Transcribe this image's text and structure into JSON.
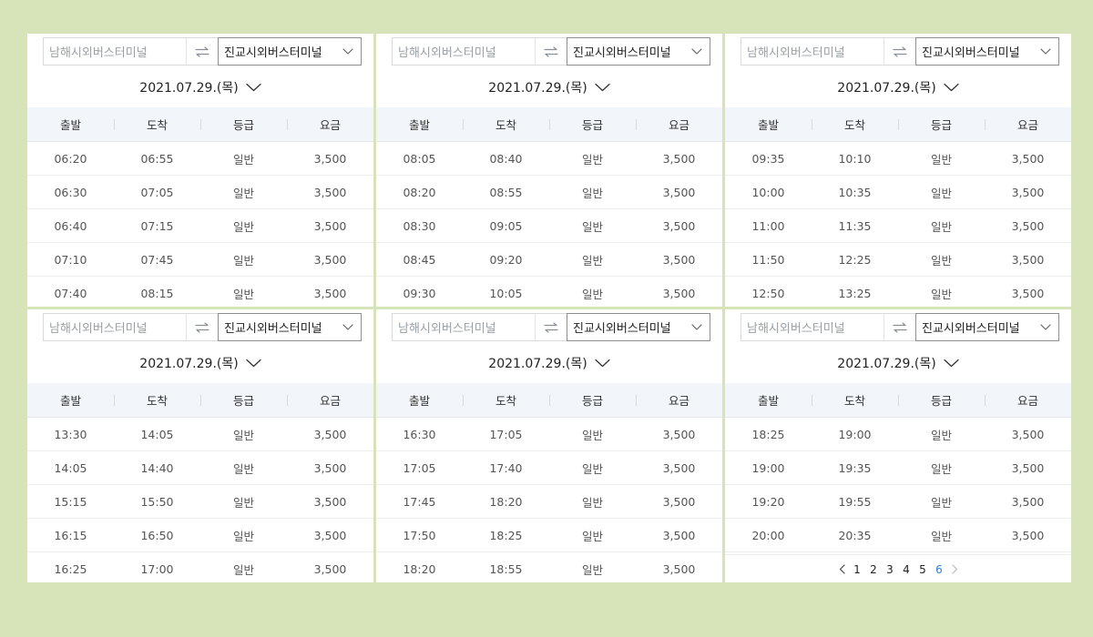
{
  "common": {
    "origin_placeholder": "남해시외버스터미널",
    "destination": "진교시외버스터미널",
    "date": "2021.07.29.(목)",
    "headers": [
      "출발",
      "도착",
      "등급",
      "요금"
    ]
  },
  "panels": [
    {
      "rows": [
        [
          "06:20",
          "06:55",
          "일반",
          "3,500"
        ],
        [
          "06:30",
          "07:05",
          "일반",
          "3,500"
        ],
        [
          "06:40",
          "07:15",
          "일반",
          "3,500"
        ],
        [
          "07:10",
          "07:45",
          "일반",
          "3,500"
        ],
        [
          "07:40",
          "08:15",
          "일반",
          "3,500"
        ]
      ]
    },
    {
      "rows": [
        [
          "08:05",
          "08:40",
          "일반",
          "3,500"
        ],
        [
          "08:20",
          "08:55",
          "일반",
          "3,500"
        ],
        [
          "08:30",
          "09:05",
          "일반",
          "3,500"
        ],
        [
          "08:45",
          "09:20",
          "일반",
          "3,500"
        ],
        [
          "09:30",
          "10:05",
          "일반",
          "3,500"
        ]
      ]
    },
    {
      "rows": [
        [
          "09:35",
          "10:10",
          "일반",
          "3,500"
        ],
        [
          "10:00",
          "10:35",
          "일반",
          "3,500"
        ],
        [
          "11:00",
          "11:35",
          "일반",
          "3,500"
        ],
        [
          "11:50",
          "12:25",
          "일반",
          "3,500"
        ],
        [
          "12:50",
          "13:25",
          "일반",
          "3,500"
        ]
      ]
    },
    {
      "rows": [
        [
          "13:30",
          "14:05",
          "일반",
          "3,500"
        ],
        [
          "14:05",
          "14:40",
          "일반",
          "3,500"
        ],
        [
          "15:15",
          "15:50",
          "일반",
          "3,500"
        ],
        [
          "16:15",
          "16:50",
          "일반",
          "3,500"
        ],
        [
          "16:25",
          "17:00",
          "일반",
          "3,500"
        ]
      ]
    },
    {
      "rows": [
        [
          "16:30",
          "17:05",
          "일반",
          "3,500"
        ],
        [
          "17:05",
          "17:40",
          "일반",
          "3,500"
        ],
        [
          "17:45",
          "18:20",
          "일반",
          "3,500"
        ],
        [
          "17:50",
          "18:25",
          "일반",
          "3,500"
        ],
        [
          "18:20",
          "18:55",
          "일반",
          "3,500"
        ]
      ]
    },
    {
      "rows": [
        [
          "18:25",
          "19:00",
          "일반",
          "3,500"
        ],
        [
          "19:00",
          "19:35",
          "일반",
          "3,500"
        ],
        [
          "19:20",
          "19:55",
          "일반",
          "3,500"
        ],
        [
          "20:00",
          "20:35",
          "일반",
          "3,500"
        ]
      ]
    }
  ],
  "pagination": {
    "pages": [
      "1",
      "2",
      "3",
      "4",
      "5",
      "6"
    ],
    "current": "6"
  },
  "colors": {
    "background": "#d7e4ba",
    "header_bg": "#f2f5f9",
    "active_page": "#2f7de1"
  },
  "icons": {
    "swap": "swap-arrows-icon",
    "dropdown": "chevron-down-icon",
    "prev": "chevron-left-icon",
    "next": "chevron-right-icon"
  }
}
